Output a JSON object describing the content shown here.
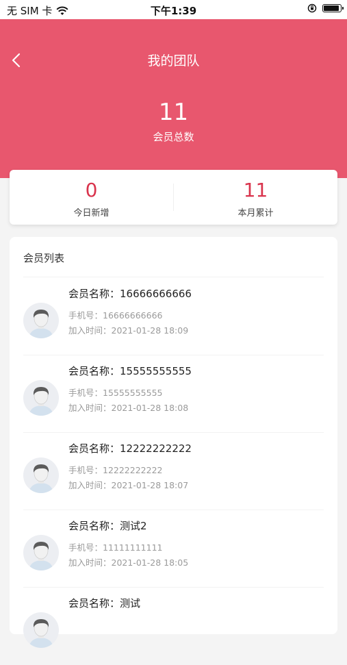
{
  "status_bar": {
    "carrier": "无 SIM 卡",
    "time": "下午1:39",
    "battery_level": 0.9
  },
  "header": {
    "title": "我的团队",
    "total_count": "11",
    "total_label": "会员总数",
    "background_color": "#e8576e"
  },
  "stats": {
    "today_new": "0",
    "today_new_label": "今日新增",
    "month_total": "11",
    "month_total_label": "本月累计",
    "number_color": "#d9344d"
  },
  "member_list": {
    "title": "会员列表",
    "items": [
      {
        "name": "会员名称：16666666666",
        "phone": "手机号：16666666666",
        "joined": "加入时间：2021-01-28 18:09"
      },
      {
        "name": "会员名称：15555555555",
        "phone": "手机号：15555555555",
        "joined": "加入时间：2021-01-28 18:08"
      },
      {
        "name": "会员名称：12222222222",
        "phone": "手机号：12222222222",
        "joined": "加入时间：2021-01-28 18:07"
      },
      {
        "name": "会员名称：测试2",
        "phone": "手机号：11111111111",
        "joined": "加入时间：2021-01-28 18:05"
      },
      {
        "name": "会员名称：测试",
        "phone": "",
        "joined": ""
      }
    ]
  },
  "icons": [
    "back-icon",
    "wifi-icon",
    "orientation-lock-icon",
    "battery-icon",
    "avatar-icon"
  ]
}
